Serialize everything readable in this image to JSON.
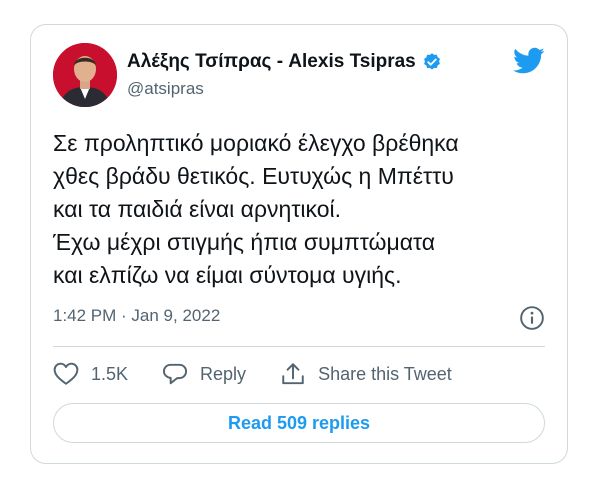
{
  "author": {
    "display_name": "Αλέξης Τσίπρας - Alexis Tsipras",
    "handle": "@atsipras",
    "verified": true,
    "avatar_icon": "profile-photo-icon"
  },
  "tweet": {
    "text": "Σε προληπτικό μοριακό έλεγχο βρέθηκα\nχθες βράδυ θετικός. Ευτυχώς η Μπέττυ\nκαι τα παιδιά είναι αρνητικοί.\nΈχω μέχρι στιγμής ήπια συμπτώματα\nκαι ελπίζω να είμαι σύντομα υγιής.",
    "timestamp": "1:42 PM · Jan 9, 2022"
  },
  "actions": {
    "like_count": "1.5K",
    "reply_label": "Reply",
    "share_label": "Share this Tweet"
  },
  "read_replies_label": "Read 509 replies",
  "colors": {
    "accent": "#1d9bf0",
    "muted": "#536471",
    "border": "#cfd9de"
  }
}
